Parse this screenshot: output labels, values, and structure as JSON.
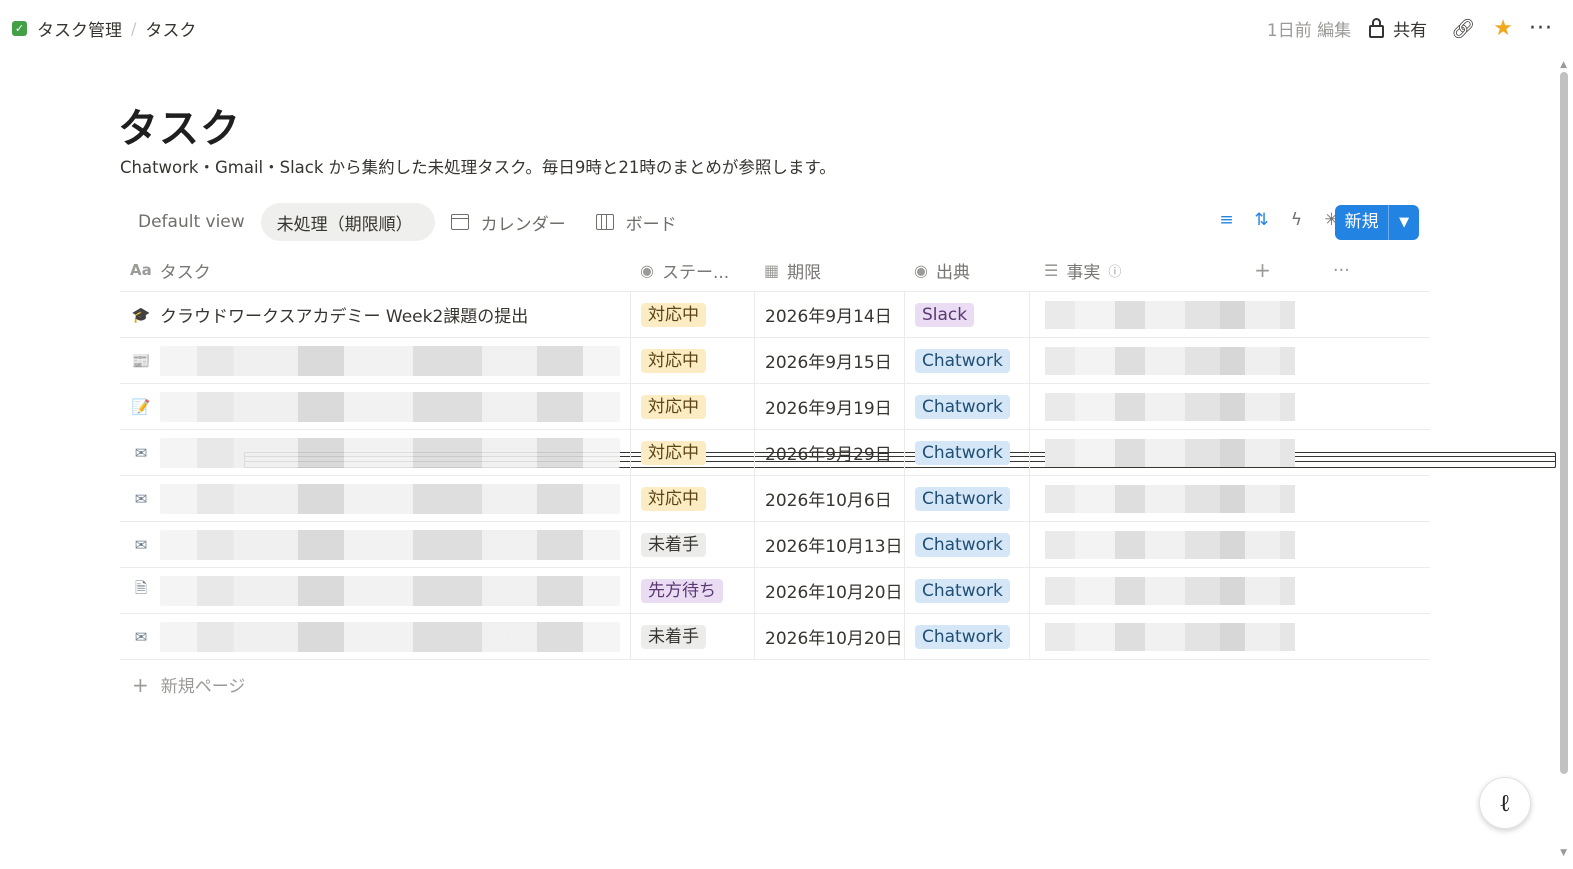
{
  "breadcrumb": {
    "parent": "タスク管理",
    "separator": "/",
    "current": "タスク"
  },
  "topbar": {
    "edited": "1日前 編集",
    "share_label": "共有"
  },
  "page": {
    "title": "タスク",
    "description": "Chatwork・Gmail・Slack から集約した未処理タスク。毎日9時と21時のまとめが参照します。"
  },
  "views": [
    {
      "label": "Default view",
      "icon": "table-icon",
      "active": false
    },
    {
      "label": "未処理（期限順）",
      "icon": "table-icon",
      "active": true
    },
    {
      "label": "カレンダー",
      "icon": "calendar-icon",
      "active": false
    },
    {
      "label": "ボード",
      "icon": "board-icon",
      "active": false
    }
  ],
  "toolbar": {
    "new_label": "新規",
    "accent": "#2383e2"
  },
  "columns": {
    "task": "タスク",
    "status": "ステー...",
    "due": "期限",
    "source": "出典",
    "fact": "事実"
  },
  "rows": [
    {
      "icon": "🎓",
      "title": "クラウドワークスアカデミー Week2課題の提出",
      "status": "対応中",
      "status_color": "yellow",
      "due": "2026年9月14日",
      "source": "Slack",
      "source_color": "purple"
    },
    {
      "icon": "📰",
      "title": "",
      "status": "対応中",
      "status_color": "yellow",
      "due": "2026年9月15日",
      "source": "Chatwork",
      "source_color": "blue"
    },
    {
      "icon": "📝",
      "title": "",
      "status": "対応中",
      "status_color": "yellow",
      "due": "2026年9月19日",
      "source": "Chatwork",
      "source_color": "blue"
    },
    {
      "icon": "✉",
      "title": "",
      "status": "対応中",
      "status_color": "yellow",
      "due": "2026年9月29日",
      "source": "Chatwork",
      "source_color": "blue"
    },
    {
      "icon": "✉",
      "title": "",
      "status": "対応中",
      "status_color": "yellow",
      "due": "2026年10月6日",
      "source": "Chatwork",
      "source_color": "blue"
    },
    {
      "icon": "✉",
      "title": "",
      "status": "未着手",
      "status_color": "gray",
      "due": "2026年10月13日",
      "source": "Chatwork",
      "source_color": "blue"
    },
    {
      "icon": "🗎",
      "title": "",
      "status": "先方待ち",
      "status_color": "purple",
      "due": "2026年10月20日",
      "source": "Chatwork",
      "source_color": "blue"
    },
    {
      "icon": "✉",
      "title": "",
      "status": "未着手",
      "status_color": "gray",
      "due": "2026年10月20日",
      "source": "Chatwork",
      "source_color": "blue"
    }
  ],
  "add_row_label": "新規ページ"
}
